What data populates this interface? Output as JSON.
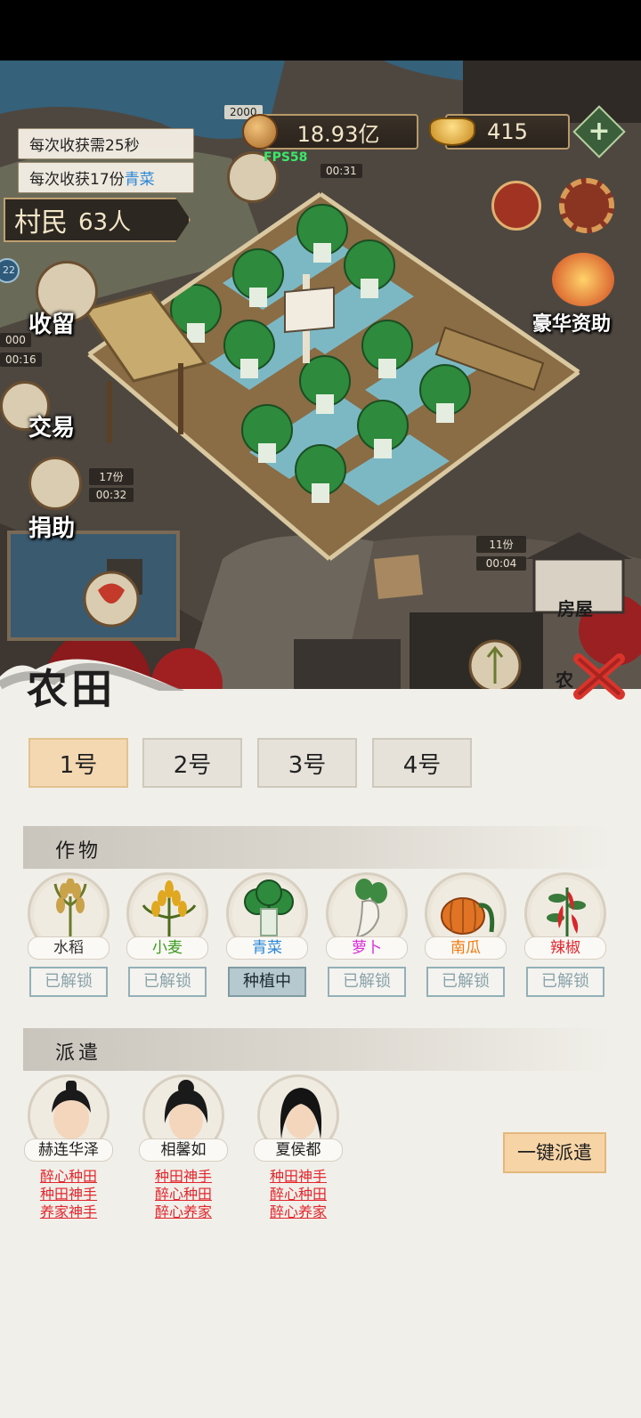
{
  "hud": {
    "harvest_time": "每次收获需25秒",
    "harvest_amount_prefix": "每次收获17份",
    "harvest_crop": "青菜",
    "coins": "18.93亿",
    "ingots": "415",
    "plus": "+",
    "fps": "FPS58",
    "villagers_label": "村民",
    "villagers_count": "63人",
    "timer_top_a": "2000",
    "timer_top_b": "00:31",
    "timer_left_a": "000",
    "timer_left_b": "00:16",
    "timer_mid_a": "17份",
    "timer_mid_b": "00:32",
    "timer_right_a": "11份",
    "timer_right_b": "00:04",
    "left_badge": "22"
  },
  "map_labels": {
    "take_in": "收留",
    "trade": "交易",
    "donate": "捐助",
    "luxury_aid": "豪华资助",
    "house": "房屋",
    "farm_partial": "农"
  },
  "panel": {
    "title": "农田",
    "field_tabs": [
      "1号",
      "2号",
      "3号",
      "4号"
    ],
    "active_field": 0,
    "crops_section": "作物",
    "dispatch_section": "派遣",
    "crops": [
      {
        "name": "水稻",
        "color": "#333333",
        "status": "已解锁",
        "icon": "rice-icon"
      },
      {
        "name": "小麦",
        "color": "#3a9b1f",
        "status": "已解锁",
        "icon": "wheat-icon"
      },
      {
        "name": "青菜",
        "color": "#2a86d8",
        "status": "种植中",
        "icon": "bok-choy-icon"
      },
      {
        "name": "萝卜",
        "color": "#d830d8",
        "status": "已解锁",
        "icon": "radish-icon"
      },
      {
        "name": "南瓜",
        "color": "#f07a10",
        "status": "已解锁",
        "icon": "pumpkin-icon"
      },
      {
        "name": "辣椒",
        "color": "#e0262d",
        "status": "已解锁",
        "icon": "chili-icon"
      }
    ],
    "active_crop": 2,
    "workers": [
      {
        "name": "赫连华泽",
        "traits": [
          "醉心种田",
          "种田神手",
          "养家神手"
        ]
      },
      {
        "name": "相馨如",
        "traits": [
          "种田神手",
          "醉心种田",
          "醉心养家"
        ]
      },
      {
        "name": "夏侯都",
        "traits": [
          "种田神手",
          "醉心种田",
          "醉心养家"
        ]
      }
    ],
    "dispatch_all": "一键派遣"
  }
}
